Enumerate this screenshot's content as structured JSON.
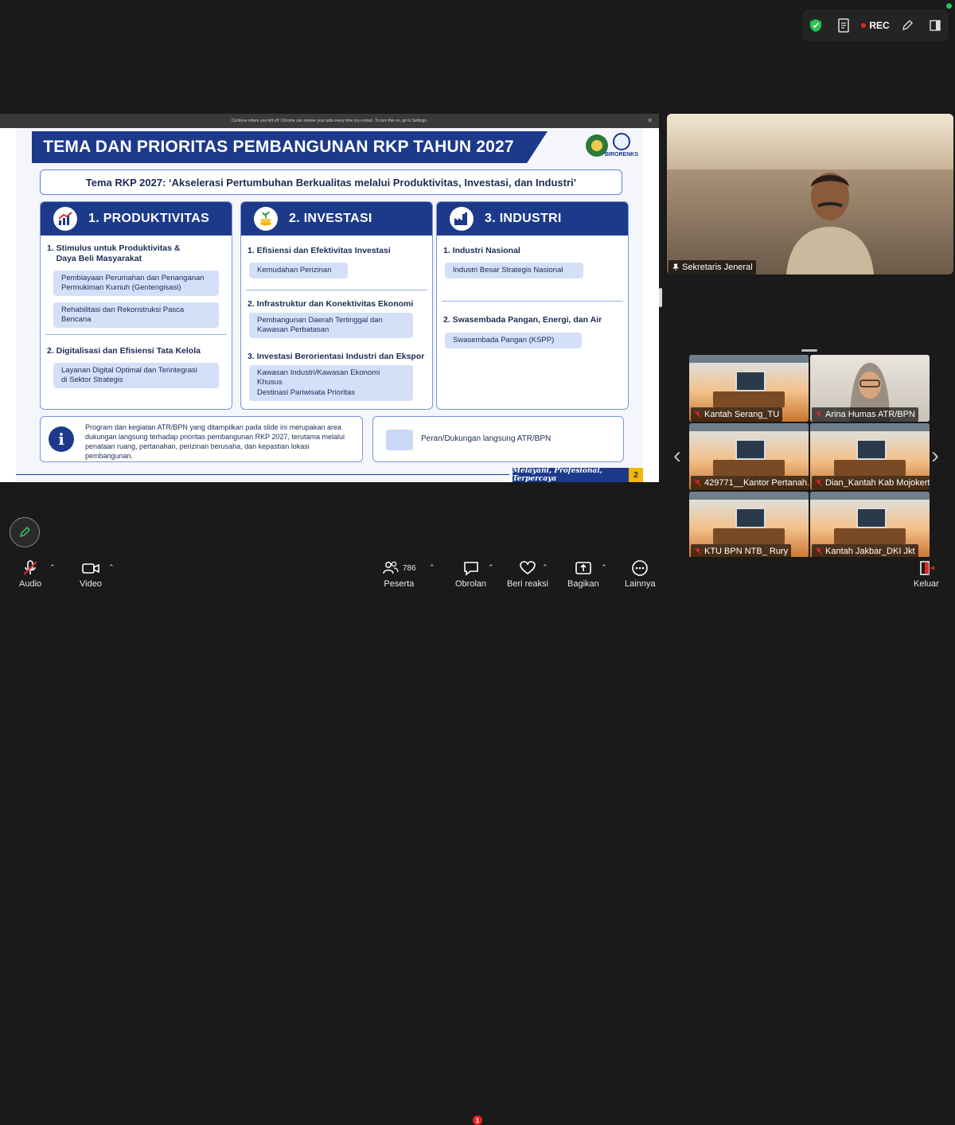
{
  "toolbar": {
    "rec_label": "REC"
  },
  "slide": {
    "notice": "Continue where you left off: Chrome can restore your tabs every time you restart. To turn this on, go to Settings.",
    "title": "TEMA DAN PRIORITAS PEMBANGUNAN RKP TAHUN 2027",
    "org_label": "BIRORENKS",
    "tema": "Tema RKP 2027: ‘Akselerasi Pertumbuhan Berkualitas melalui Produktivitas, Investasi, dan Industri’",
    "columns": [
      {
        "title": "1. PRODUKTIVITAS",
        "sections": [
          {
            "heading": "1. Stimulus untuk Produktivitas &\n    Daya Beli Masyarakat",
            "items": [
              "Pembiayaan Perumahan dan Penanganan\nPermukiman Kumuh (Gentengisasi)",
              "Rehabilitasi dan Rekonstruksi Pasca Bencana"
            ]
          },
          {
            "heading": "2. Digitalisasi dan Efisiensi Tata Kelola",
            "items": [
              "Layanan Digital Optimal dan Terintegrasi\ndi Sektor Strategis"
            ]
          }
        ]
      },
      {
        "title": "2. INVESTASI",
        "sections": [
          {
            "heading": "1. Efisiensi dan Efektivitas Investasi",
            "items": [
              "Kemudahan Perizinan"
            ]
          },
          {
            "heading": "2. Infrastruktur dan Konektivitas Ekonomi",
            "items": [
              "Pembangunan Daerah Tertinggal dan\nKawasan Perbatasan"
            ]
          },
          {
            "heading": "3. Investasi Berorientasi Industri dan Ekspor",
            "items": [
              "Kawasan Industri/Kawasan Ekonomi Khusus",
              "Destinasi Pariwisata Prioritas"
            ]
          }
        ]
      },
      {
        "title": "3. INDUSTRI",
        "sections": [
          {
            "heading": "1. Industri Nasional",
            "items": [
              "Industri Besar Strategis Nasional"
            ]
          },
          {
            "heading": "2. Swasembada Pangan, Energi, dan Air",
            "items": [
              "Swasembada Pangan (KSPP)"
            ]
          }
        ]
      }
    ],
    "info_text": "Program dan kegiatan ATR/BPN yang ditampilkan pada slide ini merupakan area dukungan langsung terhadap prioritas pembangunan RKP 2027, terutama melalui penataan ruang, pertanahan, perizinan berusaha, dan kepastian lokasi pembangunan.",
    "legend_text": "Peran/Dukungan langsung ATR/BPN",
    "footer_motto": "Melayani, Profesional, Terpercaya",
    "page_number": "2"
  },
  "speaker": {
    "name": "Sekretaris Jeneral"
  },
  "participants": [
    "Kantah Serang_TU",
    "Arina Humas ATR/BPN",
    "429771__Kantor Pertanah...",
    "Dian_Kantah Kab Mojokerto",
    "KTU BPN NTB_ Rury",
    "Kantah Jakbar_DKI Jkt"
  ],
  "bottom_bar": {
    "audio": "Audio",
    "video": "Video",
    "participants_label": "Peserta",
    "participants_count": "786",
    "chat": "Obrolan",
    "chat_badge": "1",
    "reactions": "Beri reaksi",
    "share": "Bagikan",
    "more": "Lainnya",
    "leave": "Keluar"
  },
  "colors": {
    "brand_blue": "#1d3a8a",
    "pill_blue": "#d3e0f7",
    "rec_red": "#e02828",
    "secure_green": "#23c552"
  }
}
